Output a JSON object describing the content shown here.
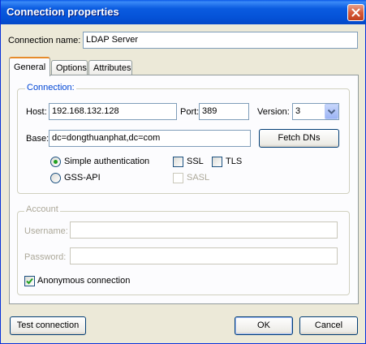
{
  "window": {
    "title": "Connection properties",
    "title_bar_color": "#0553d8"
  },
  "connection_name": {
    "label": "Connection name:",
    "value": "LDAP Server"
  },
  "tabs": [
    {
      "label": "General",
      "active": true
    },
    {
      "label": "Options",
      "active": false
    },
    {
      "label": "Attributes",
      "active": false
    }
  ],
  "connection_group": {
    "title": "Connection:",
    "host_label": "Host:",
    "host_value": "192.168.132.128",
    "port_label": "Port:",
    "port_value": "389",
    "version_label": "Version:",
    "version_value": "3",
    "base_label": "Base:",
    "base_value": "dc=dongthuanphat,dc=com",
    "fetch_dns_label": "Fetch DNs",
    "simple_auth_label": "Simple authentication",
    "simple_auth_selected": true,
    "gss_api_label": "GSS-API",
    "ssl_label": "SSL",
    "tls_label": "TLS",
    "sasl_label": "SASL"
  },
  "account_group": {
    "title": "Account",
    "username_label": "Username:",
    "username_value": "",
    "password_label": "Password:",
    "password_value": "",
    "anonymous_label": "Anonymous connection",
    "anonymous_checked": true
  },
  "buttons": {
    "test_connection": "Test connection",
    "ok": "OK",
    "cancel": "Cancel"
  },
  "icons": {
    "close": "close-icon",
    "dropdown": "chevron-down-icon",
    "check": "checkmark-icon"
  }
}
